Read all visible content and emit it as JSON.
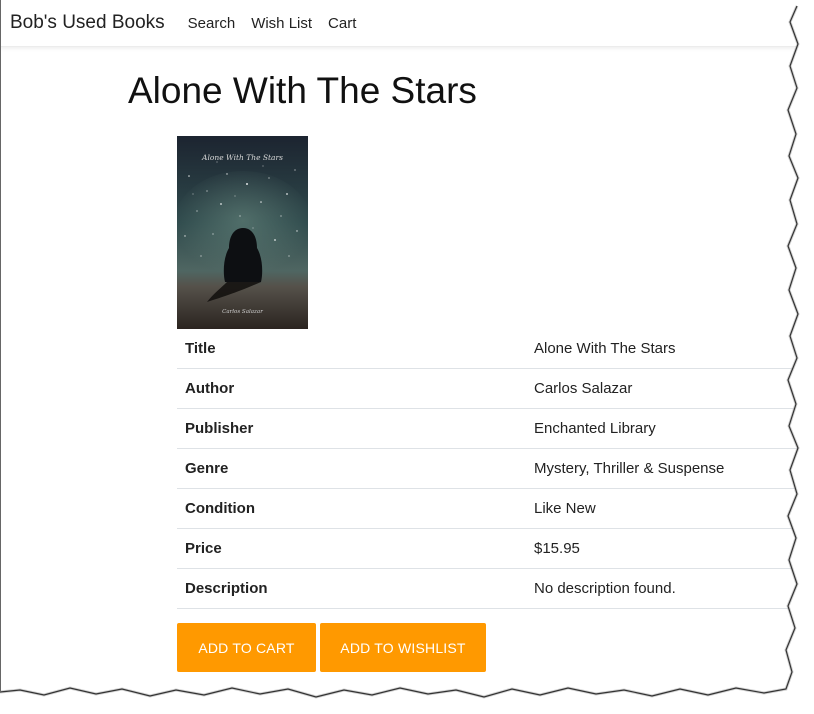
{
  "navbar": {
    "brand": "Bob's Used Books",
    "links": [
      "Search",
      "Wish List",
      "Cart"
    ]
  },
  "book": {
    "heading": "Alone With The Stars",
    "cover": {
      "title_text": "Alone With The Stars",
      "author_text": "Carlos Salazar",
      "icon": "book-cover-image"
    },
    "details": [
      {
        "key": "Title",
        "value": "Alone With The Stars"
      },
      {
        "key": "Author",
        "value": "Carlos Salazar"
      },
      {
        "key": "Publisher",
        "value": "Enchanted Library"
      },
      {
        "key": "Genre",
        "value": "Mystery, Thriller & Suspense"
      },
      {
        "key": "Condition",
        "value": "Like New"
      },
      {
        "key": "Price",
        "value": "$15.95"
      },
      {
        "key": "Description",
        "value": "No description found."
      }
    ]
  },
  "actions": {
    "add_to_cart": "ADD TO CART",
    "add_to_wishlist": "ADD TO WISHLIST"
  },
  "colors": {
    "accent": "#ff9900",
    "text": "#212529",
    "divider": "#dee2e6"
  }
}
